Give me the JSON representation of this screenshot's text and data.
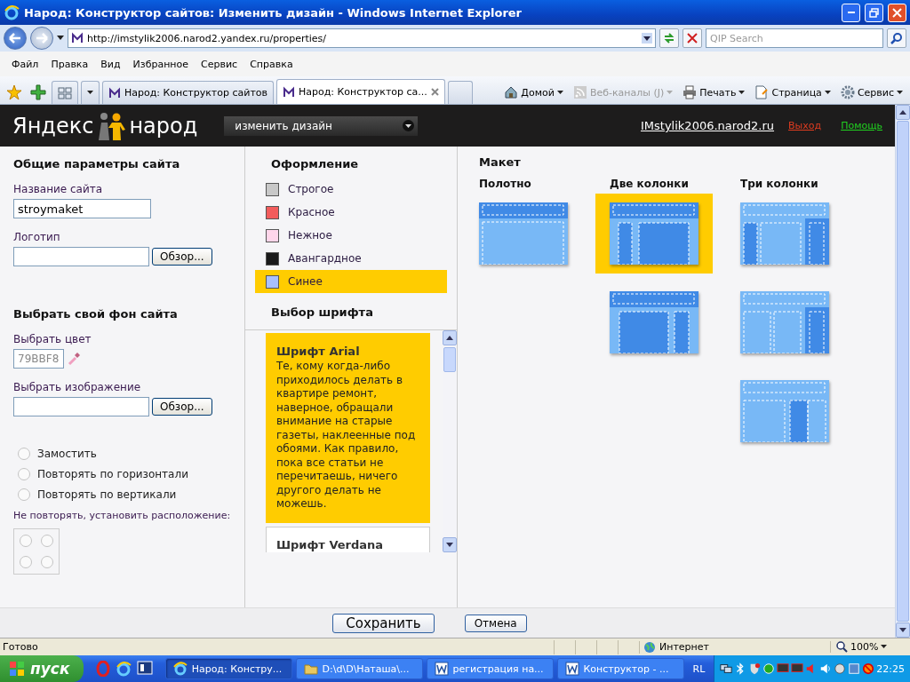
{
  "window": {
    "title": "Народ: Конструктор сайтов: Изменить дизайн - Windows Internet Explorer"
  },
  "address_bar": {
    "url": "http://imstylik2006.narod2.yandex.ru/properties/",
    "search_placeholder": "QIP Search"
  },
  "menu": [
    "Файл",
    "Правка",
    "Вид",
    "Избранное",
    "Сервис",
    "Справка"
  ],
  "tabs": [
    {
      "label": "Народ: Конструктор сайтов",
      "selected": false
    },
    {
      "label": "Народ: Конструктор са...",
      "selected": true
    }
  ],
  "commands": [
    {
      "label": "Домой",
      "kind": "home",
      "disabled": false
    },
    {
      "label": "Веб-каналы (J)",
      "kind": "feed",
      "disabled": true
    },
    {
      "label": "Печать",
      "kind": "print",
      "disabled": false
    },
    {
      "label": "Страница",
      "kind": "page",
      "disabled": false
    },
    {
      "label": "Сервис",
      "kind": "gear",
      "disabled": false
    }
  ],
  "header": {
    "logo_left": "Яндекс",
    "logo_right": "народ",
    "menu_value": "изменить дизайн",
    "user": "IMstylik2006.narod2.ru",
    "logout": "Выход",
    "help": "Помощь"
  },
  "general": {
    "title": "Общие параметры сайта",
    "name_label": "Название сайта",
    "name_value": "stroymaket",
    "logo_label": "Логотип",
    "browse": "Обзор...",
    "bg_title": "Выбрать свой фон сайта",
    "color_label": "Выбрать цвет",
    "color_value": "79BBF8",
    "image_label": "Выбрать изображение",
    "image_browse": "Обзор...",
    "repeat": [
      {
        "label": "Замостить",
        "selected": false
      },
      {
        "label": "Повторять по горизонтали",
        "selected": false
      },
      {
        "label": "Повторять по вертикали",
        "selected": false
      }
    ],
    "position_label": "Не повторять, установить расположение:",
    "positions": [
      {
        "selected": false
      },
      {
        "selected": false
      },
      {
        "selected": false
      },
      {
        "selected": false
      }
    ]
  },
  "design": {
    "title": "Оформление",
    "themes": [
      {
        "label": "Строгое",
        "color": "#c8c8c8",
        "selected": false
      },
      {
        "label": "Красное",
        "color": "#f25c5c",
        "selected": false
      },
      {
        "label": "Нежное",
        "color": "#ffd6ea",
        "selected": false
      },
      {
        "label": "Авангардное",
        "color": "#1a1a1a",
        "selected": false
      },
      {
        "label": "Синее",
        "color": "#a8c0ff",
        "selected": true
      }
    ],
    "fonts_title": "Выбор шрифта",
    "fonts": [
      {
        "title": "Шрифт Arial",
        "text": "Те, кому когда-либо приходилось делать в квартире ремонт, наверное, обращали внимание на старые газеты, наклеенные под обоями. Как правило, пока все статьи не перечитаешь, ничего другого делать не можешь.",
        "selected": true
      },
      {
        "title": "Шрифт Verdana",
        "selected": false
      }
    ]
  },
  "layout": {
    "title": "Макет",
    "columns": [
      {
        "title": "Полотно",
        "options": [
          {
            "kind": "single",
            "selected": false
          }
        ]
      },
      {
        "title": "Две колонки",
        "options": [
          {
            "kind": "left-sidebar",
            "selected": true
          },
          {
            "kind": "right-sidebar",
            "selected": false
          }
        ]
      },
      {
        "title": "Три колонки",
        "options": [
          {
            "kind": "three-a",
            "selected": false
          },
          {
            "kind": "three-b",
            "selected": false
          },
          {
            "kind": "three-c",
            "selected": false
          }
        ]
      }
    ]
  },
  "buttons": [
    "Сохранить",
    "Отмена"
  ],
  "status_bar": {
    "text": "Готово",
    "zone": "Интернет",
    "zoom": "100%"
  },
  "taskbar": {
    "start": "пуск",
    "tasks": [
      {
        "label": "Народ: Констру...",
        "kind": "ie",
        "selected": true
      },
      {
        "label": "D:\\d\\D\\Наташа\\...",
        "kind": "folder",
        "selected": false
      },
      {
        "label": "регистрация на...",
        "kind": "word",
        "selected": false
      },
      {
        "label": "Конструктор - ...",
        "kind": "word",
        "selected": false
      }
    ],
    "language": "RL",
    "clock": "22:25"
  }
}
